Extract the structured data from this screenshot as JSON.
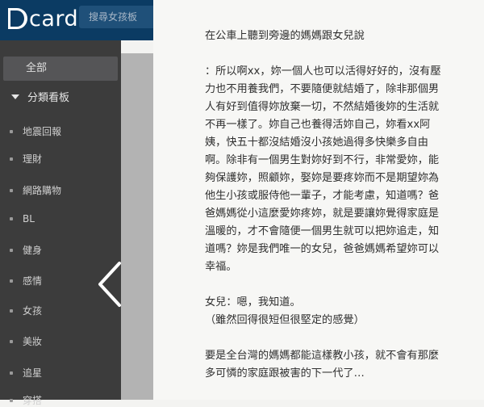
{
  "header": {
    "logo_text": "card",
    "search_placeholder": "搜尋女孩板"
  },
  "sidebar": {
    "all_label": "全部",
    "section_label": "分類看板",
    "items": [
      {
        "label": "地震回報"
      },
      {
        "label": "理財"
      },
      {
        "label": "網路購物"
      },
      {
        "label": "BL"
      },
      {
        "label": "健身"
      },
      {
        "label": "感情"
      },
      {
        "label": "女孩"
      },
      {
        "label": "美妝"
      },
      {
        "label": "追星"
      },
      {
        "label": "穿搭"
      }
    ]
  },
  "article": {
    "title": "在公車上聽到旁邊的媽媽跟女兒說",
    "para1": "：所以啊xx，妳一個人也可以活得好好的，沒有壓力也不用養我們，不要隨便就結婚了，除非那個男人有好到值得妳放棄一切，不然結婚後妳的生活就不再一樣了。妳自己也養得活妳自己，妳看xx阿姨，快五十都沒結婚沒小孩她過得多快樂多自由啊。除非有一個男生對妳好到不行，非常愛妳，能夠保護妳，照顧妳，娶妳是要疼妳而不是期望妳為他生小孩或服侍他一輩子，才能考慮，知道嗎？爸爸媽媽從小這麼愛妳疼妳，就是要讓妳覺得家庭是溫暖的，才不會隨便一個男生就可以把妳追走，知道嗎？妳是我們唯一的女兒，爸爸媽媽希望妳可以幸福。",
    "reply": "女兒：嗯，我知道。",
    "reply_note": "（雖然回得很短但很堅定的感覺）",
    "closing": "要是全台灣的媽媽都能這樣教小孩，就不會有那麼多可憐的家庭跟被害的下一代了…"
  }
}
